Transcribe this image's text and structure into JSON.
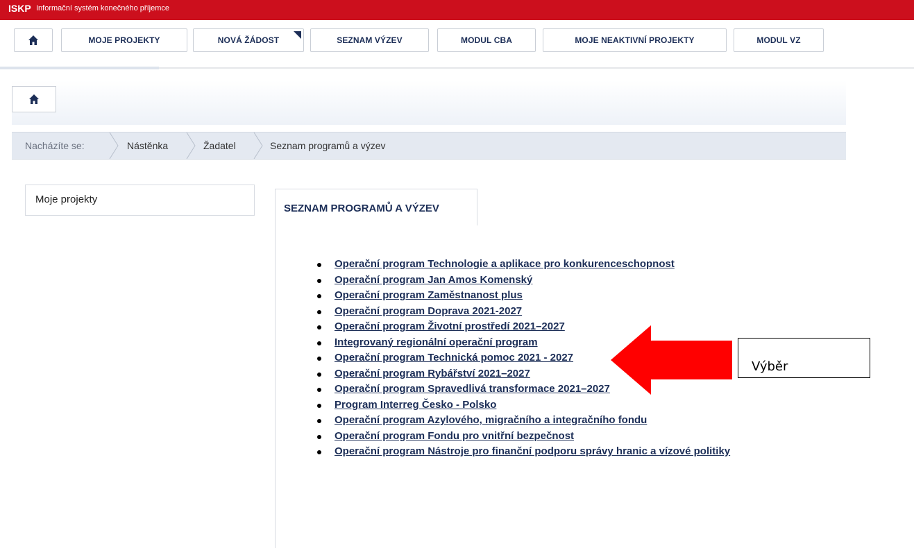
{
  "app": {
    "logo": "ISKP",
    "subtitle": "Informační systém konečného příjemce"
  },
  "nav": {
    "buttons": [
      {
        "label": "MOJE PROJEKTY"
      },
      {
        "label": "NOVÁ ŽÁDOST"
      },
      {
        "label": "SEZNAM VÝZEV"
      },
      {
        "label": "MODUL CBA"
      },
      {
        "label": "MOJE NEAKTIVNÍ PROJEKTY"
      },
      {
        "label": "MODUL VZ"
      }
    ]
  },
  "breadcrumb": {
    "prefix": "Nacházíte se:",
    "items": [
      "Nástěnka",
      "Žadatel",
      "Seznam programů a výzev"
    ]
  },
  "sidebar": {
    "item": "Moje projekty"
  },
  "tab": {
    "label": "SEZNAM PROGRAMŮ A VÝZEV"
  },
  "programs": [
    "Operační program Technologie a aplikace pro konkurenceschopnost",
    "Operační program Jan Amos Komenský",
    "Operační program Zaměstnanost plus",
    "Operační program Doprava 2021-2027",
    "Operační program Životní prostředí 2021–2027",
    "Integrovaný regionální operační program",
    "Operační program Technická pomoc 2021 - 2027",
    "Operační program Rybářství 2021–2027",
    "Operační program Spravedlivá transformace 2021–2027",
    "Program Interreg Česko - Polsko",
    "Operační program Azylového, migračního a integračního fondu",
    "Operační program Fondu pro vnitřní bezpečnost",
    "Operační program Nástroje pro finanční podporu správy hranic a vízové politiky"
  ],
  "annotation": {
    "text": "Výběr"
  },
  "colors": {
    "brand_red": "#cc0f1d",
    "nav_text": "#1c2e57",
    "arrow_red": "#ff0000"
  },
  "icons": {
    "home": "home-icon",
    "arrow": "arrow-left-icon"
  }
}
